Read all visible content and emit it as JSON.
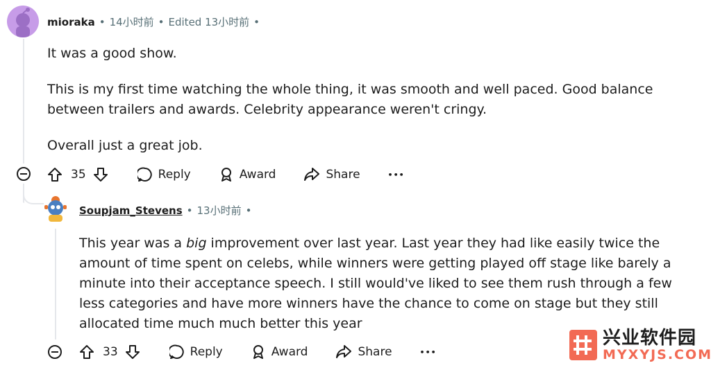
{
  "comment1": {
    "author": "mioraka",
    "time": "14小时前",
    "edited": "Edited 13小时前",
    "paragraphs": [
      "It was a good show.",
      "This is my first time watching the whole thing, it was smooth and well paced. Good balance between trailers and awards. Celebrity appearance weren't cringy.",
      "Overall just a great job."
    ],
    "votes": "35",
    "reply_label": "Reply",
    "award_label": "Award",
    "share_label": "Share",
    "more_label": "•••"
  },
  "comment2": {
    "author": "Soupjam_Stevens",
    "time": "13小时前",
    "body_before": "This year was a ",
    "body_em": "big",
    "body_after": " improvement over last year. Last year they had like easily twice the amount of time spent on celebs, while winners were getting played off stage like barely a minute into their acceptance speech. I still would've liked to see them rush through a few less categories and have more winners have the chance to come on stage but they still allocated time much much better this year",
    "votes": "33",
    "reply_label": "Reply",
    "award_label": "Award",
    "share_label": "Share",
    "more_label": "•••"
  },
  "watermark": {
    "title": "兴业软件园",
    "url": "MYXYJS.COM"
  },
  "icons": {
    "upvote": "arrow-up-icon",
    "downvote": "arrow-down-icon",
    "reply": "speech-bubble-icon",
    "award": "award-icon",
    "share": "share-arrow-icon",
    "collapse": "minus-circle-icon"
  },
  "colors": {
    "meta_gray": "#576f76",
    "avatar1": "#c79ce8",
    "watermark": "#f26a54"
  }
}
